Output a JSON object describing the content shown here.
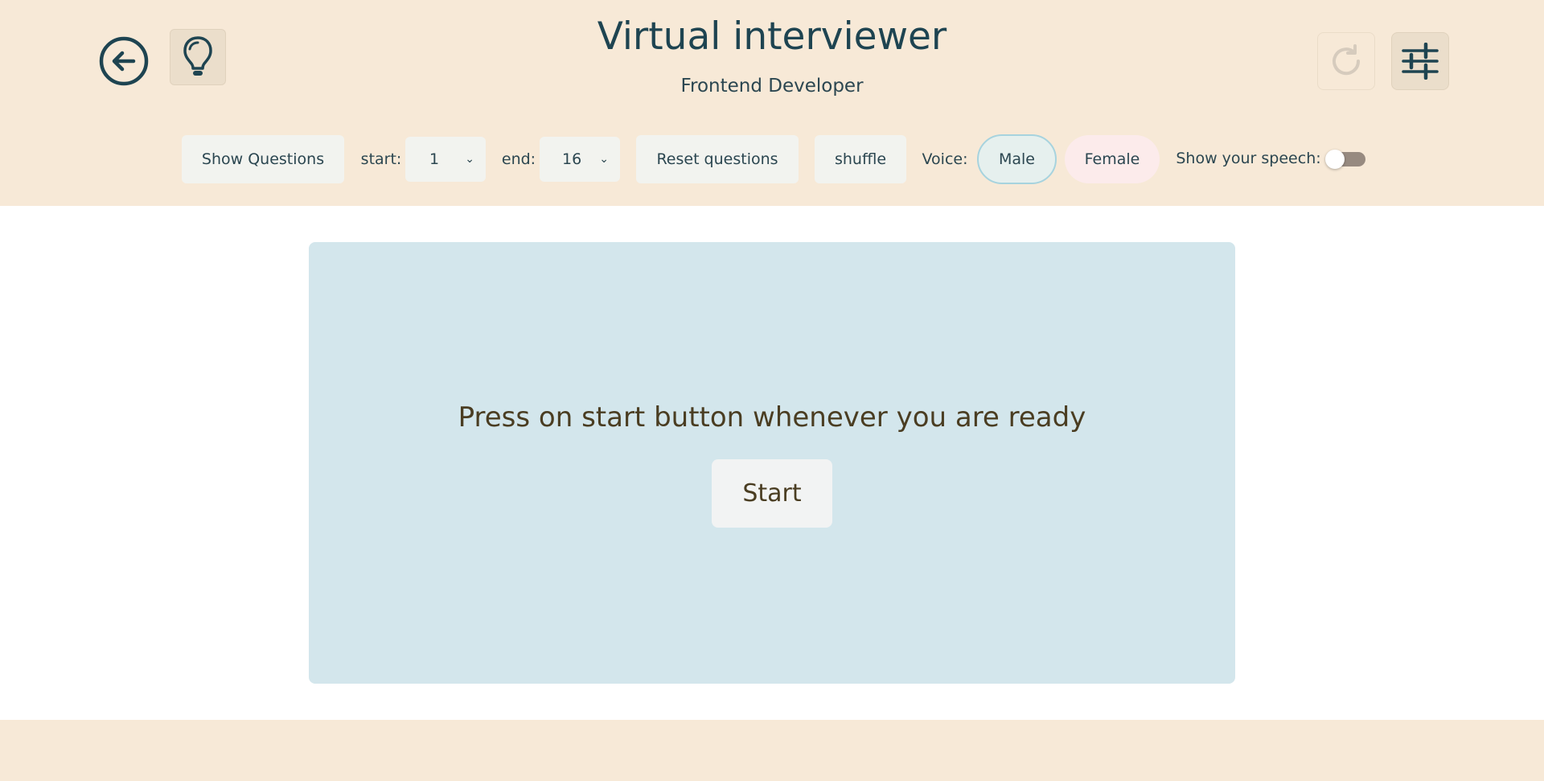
{
  "header": {
    "title": "Virtual interviewer",
    "subtitle": "Frontend Developer",
    "back_icon": "arrow-left-circle-icon",
    "hint_icon": "lightbulb-icon",
    "reload_icon": "refresh-icon",
    "settings_icon": "sliders-icon"
  },
  "toolbar": {
    "show_questions_label": "Show Questions",
    "start_label": "start:",
    "start_value": "1",
    "end_label": "end:",
    "end_value": "16",
    "reset_label": "Reset questions",
    "shuffle_label": "shuffle",
    "voice_label": "Voice:",
    "voice_options": [
      "Male",
      "Female"
    ],
    "voice_selected": "Male",
    "show_speech_label": "Show your speech:",
    "show_speech_enabled": false
  },
  "stage": {
    "prompt": "Press on start button whenever you are ready",
    "start_button_label": "Start"
  },
  "colors": {
    "header_bg": "#f7e9d7",
    "stage_bg": "#d3e6ec",
    "title_color": "#1e4451",
    "prompt_color": "#4a3d22"
  }
}
